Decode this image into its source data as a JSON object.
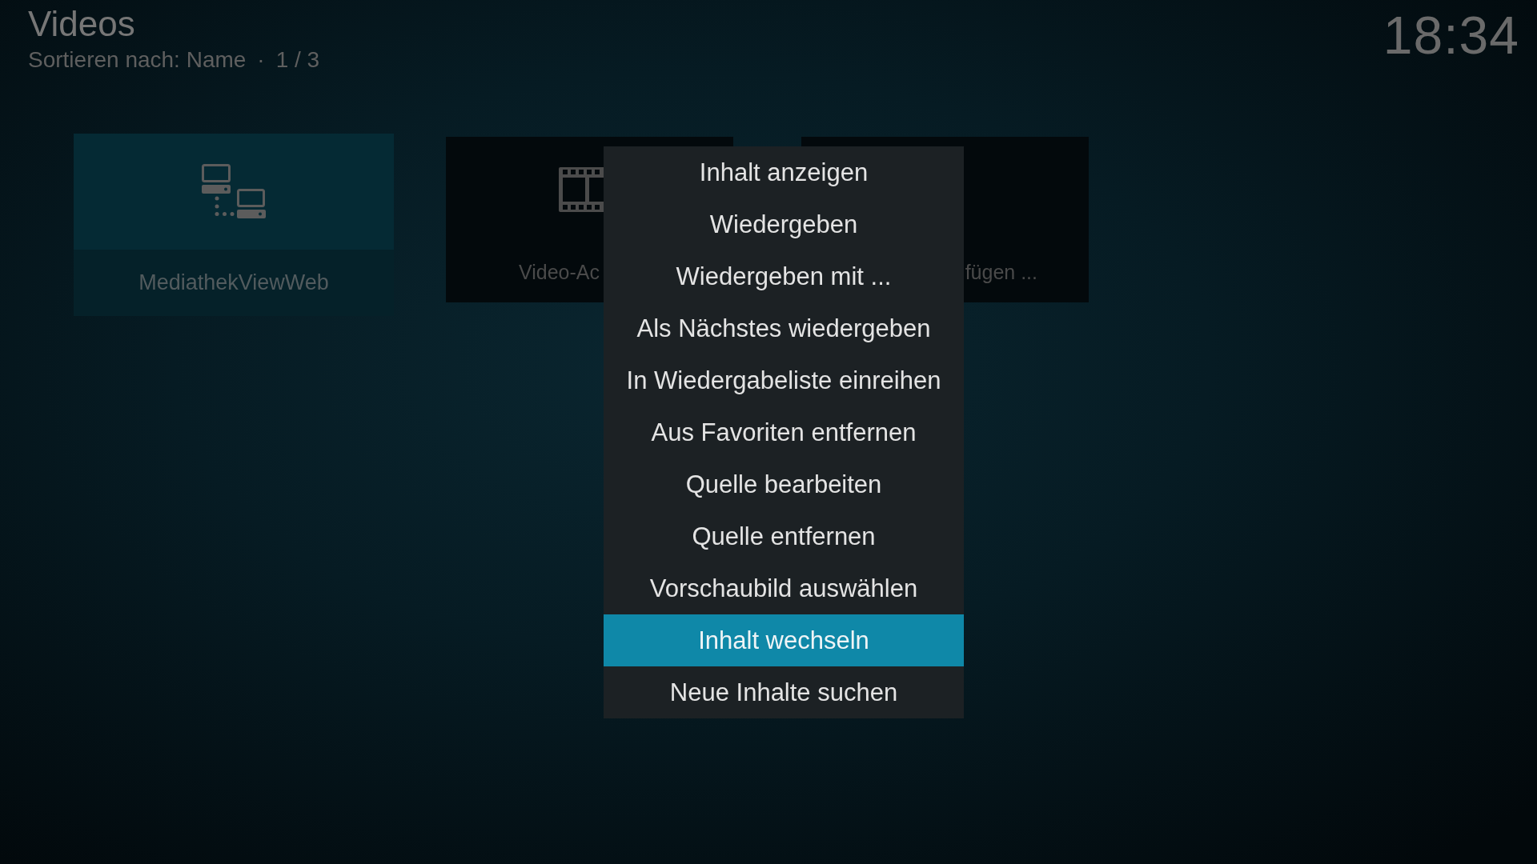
{
  "header": {
    "title": "Videos",
    "sort": "Sortieren nach: Name",
    "separator": "·",
    "page": "1 / 3"
  },
  "clock": "18:34",
  "tiles": [
    {
      "label": "MediathekViewWeb",
      "kind": "network",
      "selected": true
    },
    {
      "label": "Video-Ac",
      "kind": "film",
      "selected": false
    },
    {
      "label": "fügen ...",
      "kind": "blank",
      "selected": false
    }
  ],
  "context_menu": {
    "items": [
      {
        "label": "Inhalt anzeigen",
        "selected": false
      },
      {
        "label": "Wiedergeben",
        "selected": false
      },
      {
        "label": "Wiedergeben mit ...",
        "selected": false
      },
      {
        "label": "Als Nächstes wiedergeben",
        "selected": false
      },
      {
        "label": "In Wiedergabeliste einreihen",
        "selected": false
      },
      {
        "label": "Aus Favoriten entfernen",
        "selected": false
      },
      {
        "label": "Quelle bearbeiten",
        "selected": false
      },
      {
        "label": "Quelle entfernen",
        "selected": false
      },
      {
        "label": "Vorschaubild auswählen",
        "selected": false
      },
      {
        "label": "Inhalt wechseln",
        "selected": true
      },
      {
        "label": "Neue Inhalte suchen",
        "selected": false
      }
    ]
  }
}
